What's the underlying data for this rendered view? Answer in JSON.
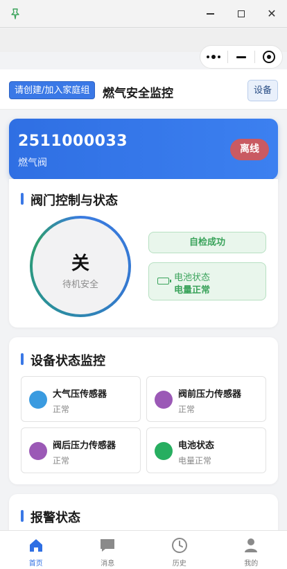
{
  "window": {
    "pin_icon": "pin-icon",
    "minimize_icon": "minimize-icon",
    "maximize_icon": "maximize-icon",
    "close_icon": "close-icon",
    "close_glyph": "✕"
  },
  "capsule": {
    "more_icon": "more-dots-icon",
    "minimize_icon": "capsule-minimize-icon",
    "close_icon": "capsule-target-icon"
  },
  "header": {
    "join_family_label": "请创建/加入家庭组",
    "title": "燃气安全监控",
    "device_button_label": "设备"
  },
  "device": {
    "id": "2511000033",
    "type": "燃气阀",
    "status_badge": "离线",
    "accent": "#3a78e6",
    "offline_color": "#c95a62"
  },
  "valve_section": {
    "title": "阀门控制与状态",
    "state": "关",
    "substate": "待机安全",
    "self_check": "自检成功",
    "battery_label": "电池状态",
    "battery_value": "电量正常",
    "ok_color": "#3aa35b"
  },
  "monitor_section": {
    "title": "设备状态监控",
    "sensors": [
      {
        "name": "大气压传感器",
        "status": "正常",
        "color": "#3a9be0"
      },
      {
        "name": "阀前压力传感器",
        "status": "正常",
        "color": "#9b59b6"
      },
      {
        "name": "阀后压力传感器",
        "status": "正常",
        "color": "#9b59b6"
      },
      {
        "name": "电池状态",
        "status": "电量正常",
        "color": "#27ae60"
      }
    ]
  },
  "alarm_section": {
    "title": "报警状态"
  },
  "nav": {
    "items": [
      {
        "label": "首页",
        "icon": "home-icon",
        "active": true
      },
      {
        "label": "消息",
        "icon": "message-icon",
        "active": false
      },
      {
        "label": "历史",
        "icon": "clock-icon",
        "active": false
      },
      {
        "label": "我的",
        "icon": "user-icon",
        "active": false
      }
    ]
  }
}
